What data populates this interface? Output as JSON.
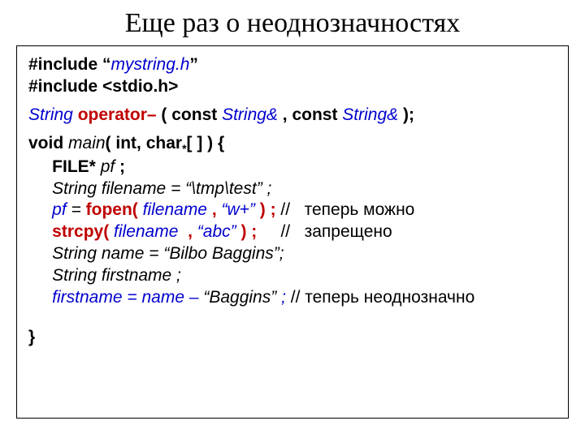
{
  "title": "Еще раз о неоднозначностях",
  "code": {
    "inc1_a": "#include “",
    "inc1_b": "mystring.h",
    "inc1_c": "”",
    "inc2": "#include <stdio.h>",
    "op_ret": "String ",
    "op_name": "operator– ",
    "op_p1a": "( const ",
    "op_p1b": "String& ",
    "op_comma": ", const ",
    "op_p2b": "String& ",
    "op_end": ");",
    "main_a": "void ",
    "main_b": "main",
    "main_c": "( int, char",
    "main_star": "*",
    "main_d": "[ ] ) {",
    "l_file_a": "     FILE* ",
    "l_file_b": "pf",
    "l_file_c": " ;",
    "l_fn": "     String filename = “\\tmp\\test” ;",
    "l_pf_a": "     pf",
    "l_pf_b": " = ",
    "l_pf_c": "fopen( ",
    "l_pf_d": "filename ",
    "l_pf_e": ", ",
    "l_pf_f": "“w+” ",
    "l_pf_g": ") ;",
    "l_pf_h": " //   теперь можно",
    "l_sc_a": "     strcpy( ",
    "l_sc_b": "filename ",
    "l_sc_c": " , ",
    "l_sc_d": "“abc” ",
    "l_sc_e": ") ;",
    "l_sc_f": "     //   запрещено",
    "l_name": "     String name = “Bilbo Baggins”;",
    "l_first": "     String firstname ;",
    "l_fa_a": "     firstname = name – ",
    "l_fa_b": "“Baggins” ",
    "l_fa_c": ";",
    "l_fa_d": " // теперь неоднозначно",
    "brace": "}"
  }
}
